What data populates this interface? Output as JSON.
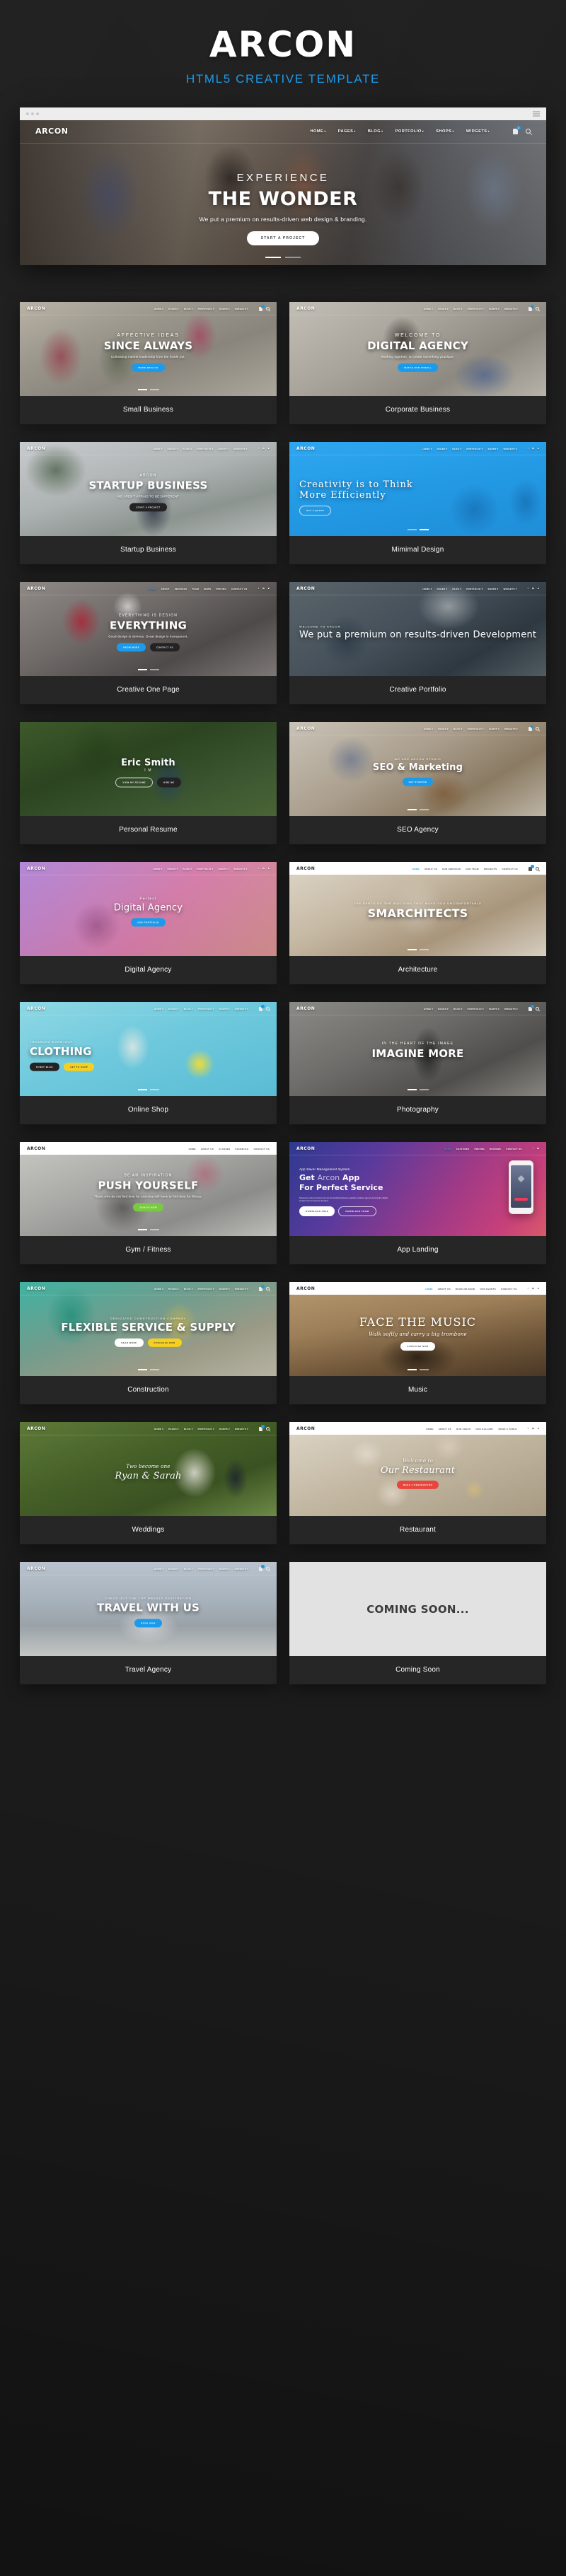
{
  "masthead": {
    "title": "ARCON",
    "subtitle": "HTML5 CREATIVE TEMPLATE"
  },
  "accent_colors": {
    "brand_blue": "#1b9bea",
    "page_background": "#1b1b1b",
    "card_background": "#262626"
  },
  "hero": {
    "logo": "ARCON",
    "menu": [
      {
        "label": "HOME",
        "caret": "▾"
      },
      {
        "label": "PAGES",
        "caret": "▾"
      },
      {
        "label": "BLOG",
        "caret": "▾"
      },
      {
        "label": "PORTFOLIO",
        "caret": "▾"
      },
      {
        "label": "SHOPS",
        "caret": "▾"
      },
      {
        "label": "WIDGETS",
        "caret": "▾"
      }
    ],
    "cart_badge": "3",
    "cart_icon": "shopping-bag-icon",
    "search_icon": "search-icon",
    "window_menu_icon": "hamburger-icon",
    "kicker": "EXPERIENCE",
    "headline": "THE WONDER",
    "description": "We put a premium on results-driven web design & branding.",
    "cta": "START A PROJECT",
    "slider_dots": 2,
    "slider_active": 0
  },
  "demos": [
    {
      "label": "Small Business",
      "bg": "bg-small-business",
      "nav": {
        "logo": "ARCON",
        "style": "dark",
        "items": [
          "HOME ▾",
          "PAGES ▾",
          "BLOG ▾",
          "PORTFOLIO ▾",
          "SHOPS ▾",
          "WIDGETS ▾"
        ],
        "icons": [
          "cart",
          "search"
        ],
        "badge": "3"
      },
      "kicker": "AFFECTIVE IDEAS",
      "headline": "SINCE ALWAYS",
      "sub": "Cultivating market leadership from the inside out.",
      "buttons": [
        {
          "text": "WORK WITH US",
          "style": "blue"
        }
      ],
      "dots": 2
    },
    {
      "label": "Corporate Business",
      "bg": "bg-corporate",
      "nav": {
        "logo": "ARCON",
        "style": "dark",
        "items": [
          "HOME ▾",
          "PAGES ▾",
          "BLOG ▾",
          "PORTFOLIO ▾",
          "SHOPS ▾",
          "WIDGETS ▾"
        ],
        "icons": [
          "cart",
          "search"
        ],
        "badge": "3"
      },
      "kicker": "WELCOME TO",
      "headline": "DIGITAL AGENCY",
      "sub": "Working together, to create something younique.",
      "buttons": [
        {
          "text": "WATCH OUR VIDEO ▸",
          "style": "blue"
        }
      ],
      "dots": 0
    },
    {
      "label": "Startup Business",
      "bg": "bg-startup",
      "nav": {
        "logo": "ARCON",
        "style": "dark",
        "items": [
          "HOME ▾",
          "PAGES ▾",
          "BLOG ▾",
          "PORTFOLIO ▾",
          "SHOPS ▾",
          "WIDGETS ▾"
        ],
        "icons": [
          "facebook",
          "twitter",
          "instagram"
        ]
      },
      "kicker": "ARCON",
      "headline": "STARTUP BUSINESS",
      "sub": "WE AREN'T AFRAID TO BE DIFFERENT",
      "buttons": [
        {
          "text": "START A PROJECT",
          "style": "dark"
        }
      ],
      "dots": 0
    },
    {
      "label": "Mimimal Design",
      "bg": "bg-minimal",
      "nav": {
        "logo": "ARCON",
        "style": "dark",
        "items": [
          "HOME ▾",
          "PAGES ▾",
          "BLOG ▾",
          "PORTFOLIO ▾",
          "SHOPS ▾",
          "WIDGETS ▾"
        ],
        "icons": [
          "facebook",
          "twitter",
          "instagram"
        ]
      },
      "headline_serif": "Creativity is to Think\nMore Efficiently",
      "buttons": [
        {
          "text": "GET A QUOTE",
          "style": "ghost"
        }
      ],
      "dots": 2
    },
    {
      "label": "Creative One Page",
      "bg": "bg-onepage",
      "nav": {
        "logo": "ARCON",
        "style": "dark",
        "items": [
          "HOME",
          "ABOUT",
          "SERVICES",
          "TEAM",
          "NEWS",
          "PRICING",
          "CONTACT US"
        ],
        "icons": [
          "facebook",
          "twitter",
          "instagram"
        ]
      },
      "kicker": "EVERYTHING IS DESIGN",
      "headline": "EVERYTHING",
      "sub": "Good design is obvious. Great design is transparent.",
      "buttons": [
        {
          "text": "KNOW MORE",
          "style": "blue"
        },
        {
          "text": "CONTACT US",
          "style": "dark"
        }
      ],
      "dots": 2
    },
    {
      "label": "Creative Portfolio",
      "bg": "bg-portfolio",
      "nav": {
        "logo": "ARCON",
        "style": "dark",
        "items": [
          "HOME ▾",
          "PAGES ▾",
          "BLOG ▾",
          "PORTFOLIO ▾",
          "SHOPS ▾",
          "WIDGETS ▾"
        ],
        "icons": [
          "facebook",
          "twitter",
          "instagram"
        ]
      },
      "kicker": "WELCOME TO ARCON",
      "headline_left": "We put a premium on results-driven Development",
      "dots": 0
    },
    {
      "label": "Personal Resume",
      "bg": "bg-resume",
      "nav": null,
      "headline": "Eric Smith",
      "sub_big": "I M",
      "buttons": [
        {
          "text": "VIEW MY RESUME",
          "style": "ghost"
        },
        {
          "text": "HIRE ME",
          "style": "dark"
        }
      ],
      "dots": 0
    },
    {
      "label": "SEO Agency",
      "bg": "bg-seo",
      "nav": {
        "logo": "ARCON",
        "style": "dark",
        "items": [
          "HOME ▾",
          "PAGES ▾",
          "BLOG ▾",
          "PORTFOLIO ▾",
          "SHOPS ▾",
          "WIDGETS ▾"
        ],
        "icons": [
          "cart",
          "search"
        ],
        "badge": "3"
      },
      "kicker": "WE ARE ARCON STUDIO",
      "headline": "SEO & Marketing",
      "buttons": [
        {
          "text": "GET STARTED",
          "style": "blue"
        }
      ],
      "dots": 2
    },
    {
      "label": "Digital Agency",
      "bg": "bg-digital",
      "nav": {
        "logo": "ARCON",
        "style": "dark",
        "items": [
          "HOME ▾",
          "PAGES ▾",
          "BLOG ▾",
          "PORTFOLIO ▾",
          "SHOPS ▾",
          "WIDGETS ▾"
        ],
        "icons": [
          "facebook",
          "twitter",
          "instagram"
        ]
      },
      "kicker": "Perfect",
      "headline": "Digital Agency",
      "buttons": [
        {
          "text": "OUR PORTFOLIO",
          "style": "blue"
        }
      ],
      "dots": 0
    },
    {
      "label": "Architecture",
      "bg": "bg-arch",
      "nav": {
        "logo": "ARCON",
        "style": "light",
        "items": [
          "HOME",
          "ABOUT US",
          "OUR SERVICES",
          "OUR TEAM",
          "PROJECTS",
          "CONTACT US"
        ],
        "icons": [
          "cart",
          "search"
        ],
        "badge": "3"
      },
      "kicker": "THE PARTS OF THE BUILDING THAT MAKE YOU UNCOMFORTABLE",
      "headline": "SMARCHITECTS",
      "dots": 2
    },
    {
      "label": "Online Shop",
      "bg": "bg-shop",
      "nav": {
        "logo": "ARCON",
        "style": "dark",
        "items": [
          "HOME ▾",
          "PAGES ▾",
          "BLOG ▾",
          "PORTFOLIO ▾",
          "SHOPS ▾",
          "WIDGETS ▾"
        ],
        "icons": [
          "cart",
          "search"
        ],
        "badge": "3"
      },
      "kicker": "TREASURE EVERYDAY",
      "headline": "CLOTHING",
      "buttons": [
        {
          "text": "FUNNY BLOG",
          "style": "dark"
        },
        {
          "text": "GET TO SHOP",
          "style": "yellow"
        }
      ],
      "dots": 2,
      "align": "left"
    },
    {
      "label": "Photography",
      "bg": "bg-photo",
      "nav": {
        "logo": "ARCON",
        "style": "dark",
        "items": [
          "HOME ▾",
          "PAGES ▾",
          "BLOG ▾",
          "PORTFOLIO ▾",
          "SHOPS ▾",
          "WIDGETS ▾"
        ],
        "icons": [
          "cart",
          "search"
        ],
        "badge": "3"
      },
      "kicker": "IN THE HEART OF THE IMAGE",
      "headline": "IMAGINE MORE",
      "dots": 2
    },
    {
      "label": "Gym / Fitness",
      "bg": "bg-gym",
      "nav": {
        "logo": "ARCON",
        "style": "light",
        "items": [
          "HOME",
          "ABOUT US",
          "CLASSES",
          "SCHEDULE",
          "CONTACT US"
        ],
        "icons": []
      },
      "kicker": "BE AN INSPIRATION",
      "headline": "PUSH YOURSELF",
      "sub": "Those who do not find time for exercise will have to find time for illness.",
      "buttons": [
        {
          "text": "JOIN US NOW",
          "style": "green"
        }
      ],
      "dots": 2
    },
    {
      "label": "App Landing",
      "bg": "bg-app",
      "nav": {
        "logo": "ARCON",
        "style": "dark",
        "items": [
          "HOME",
          "FEATURES",
          "PRICING",
          "REVIEWS",
          "CONTACT US"
        ],
        "icons": [
          "facebook",
          "twitter"
        ]
      },
      "app": {
        "kicker": "App Saver Management System",
        "headline_a": "Get",
        "headline_dim": "Arcon",
        "headline_b": "App",
        "headline_line2": "For Perfect Service",
        "paragraph": "Started as early as internet we are the leading business analytics solutions agency serving the digital empire from the last two decades.",
        "buttons": [
          {
            "text": "DOWNLOAD FREE",
            "style": "white"
          },
          {
            "text": "DOWNLOAD FROM",
            "style": "ghost"
          }
        ]
      },
      "dots": 0
    },
    {
      "label": "Construction",
      "bg": "bg-construction",
      "nav": {
        "logo": "ARCON",
        "style": "dark",
        "items": [
          "HOME ▾",
          "PAGES ▾",
          "BLOG ▾",
          "PORTFOLIO ▾",
          "SHOPS ▾",
          "WIDGETS ▾"
        ],
        "icons": [
          "cart",
          "search"
        ],
        "badge": "3"
      },
      "kicker": "DEDICATED CONSTRUCTION COMPANY",
      "headline": "FLEXIBLE SERVICE & SUPPLY",
      "buttons": [
        {
          "text": "READ MORE",
          "style": "white"
        },
        {
          "text": "PURCHASE NOW",
          "style": "yellow"
        }
      ],
      "dots": 2
    },
    {
      "label": "Music",
      "bg": "bg-music",
      "nav": {
        "logo": "ARCON",
        "style": "light",
        "items": [
          "HOME",
          "ABOUT US",
          "BOOK OR BAND",
          "OUR EVENTS",
          "CONTACT US"
        ],
        "icons": [
          "facebook",
          "twitter",
          "instagram"
        ]
      },
      "headline_serif_1": "FACE THE MUSIC",
      "sub_script": "Walk softly and carry a big trombone",
      "buttons": [
        {
          "text": "PURCHASE NOW",
          "style": "white"
        }
      ],
      "dots": 2
    },
    {
      "label": "Weddings",
      "bg": "bg-wedding",
      "nav": {
        "logo": "ARCON",
        "style": "dark",
        "items": [
          "HOME ▾",
          "PAGES ▾",
          "BLOG ▾",
          "PORTFOLIO ▾",
          "SHOPS ▾",
          "WIDGETS ▾"
        ],
        "icons": [
          "cart",
          "search"
        ],
        "badge": "3"
      },
      "kicker_script": "Two become one",
      "headline_script": "Ryan & Sarah",
      "dots": 0
    },
    {
      "label": "Restaurant",
      "bg": "bg-restaurant",
      "nav": {
        "logo": "ARCON",
        "style": "light",
        "items": [
          "HOME",
          "ABOUT US",
          "OUR CHEFS",
          "OUR GALLERY",
          "BOOK A TABLE"
        ],
        "icons": [
          "facebook",
          "twitter",
          "instagram"
        ]
      },
      "kicker_script": "Welcome to",
      "headline_script": "Our Restaurant",
      "buttons": [
        {
          "text": "MAKE A RESERVATION",
          "style": "red"
        }
      ],
      "dots": 0
    },
    {
      "label": "Travel Agency",
      "bg": "bg-travel",
      "nav": {
        "logo": "ARCON",
        "style": "dark",
        "items": [
          "HOME ▾",
          "PAGES ▾",
          "BLOG ▾",
          "PORTFOLIO ▾",
          "SHOPS ▾",
          "WIDGETS ▾"
        ],
        "icons": [
          "cart",
          "search"
        ],
        "badge": "3"
      },
      "kicker": "CHECK OUT THE TOP WEEKLY DESTINATION",
      "headline": "TRAVEL WITH US",
      "buttons": [
        {
          "text": "BOOK NOW",
          "style": "blue"
        }
      ],
      "dots": 0
    },
    {
      "label": "Coming Soon",
      "bg": "bg-coming",
      "nav": null,
      "coming_text": "COMING SOON...",
      "dots": 0
    }
  ]
}
